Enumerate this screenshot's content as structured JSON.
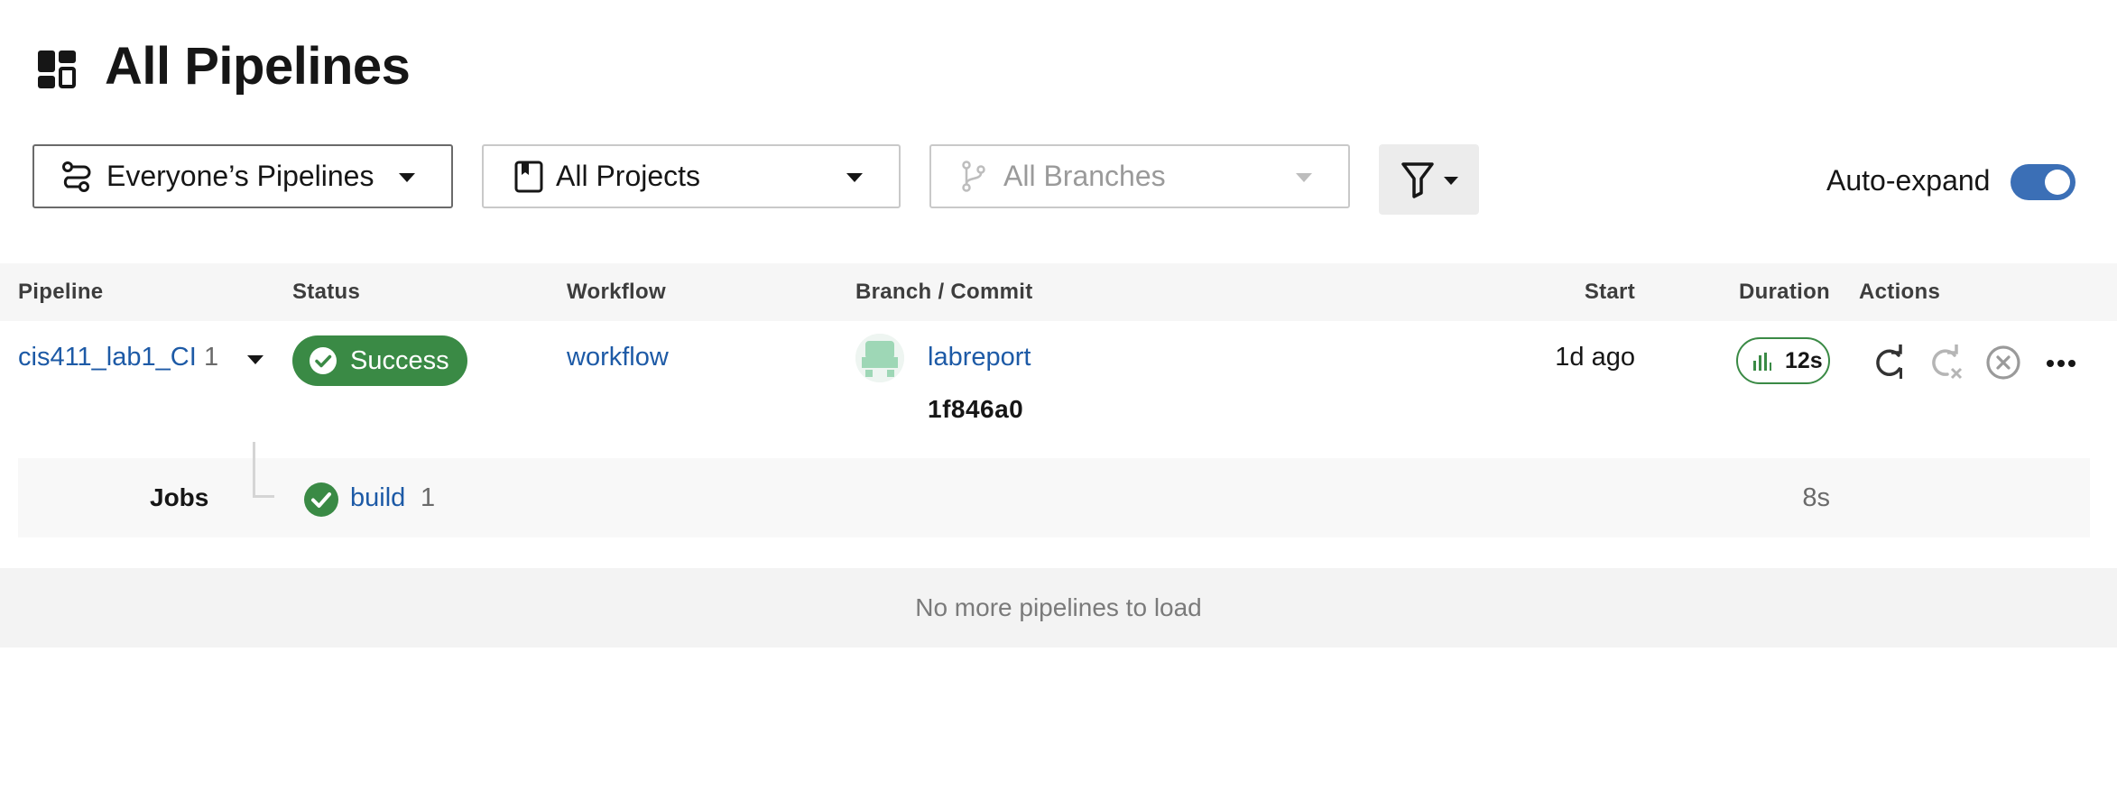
{
  "header": {
    "title": "All Pipelines",
    "icon": "dashboard-icon"
  },
  "filters": {
    "owner": {
      "label": "Everyone’s Pipelines",
      "icon": "pipelines-icon"
    },
    "project": {
      "label": "All Projects",
      "icon": "bookmark-icon"
    },
    "branch": {
      "label": "All Branches",
      "icon": "branch-icon",
      "disabled": true
    },
    "filter_button_icon": "filter-icon",
    "auto_expand": {
      "label": "Auto-expand",
      "on": true
    }
  },
  "table": {
    "columns": {
      "pipeline": "Pipeline",
      "status": "Status",
      "workflow": "Workflow",
      "branch_commit": "Branch / Commit",
      "start": "Start",
      "duration": "Duration",
      "actions": "Actions"
    },
    "rows": [
      {
        "pipeline": "cis411_lab1_CI",
        "number": "1",
        "status": "Success",
        "workflow": "workflow",
        "branch": "labreport",
        "commit": "1f846a0",
        "start": "1d ago",
        "duration": "12s",
        "actions": [
          "rerun-icon",
          "rerun-failed-icon",
          "cancel-icon",
          "more-icon"
        ],
        "jobs": {
          "label": "Jobs",
          "items": [
            {
              "name": "build",
              "number": "1",
              "duration": "8s",
              "status": "success"
            }
          ]
        }
      }
    ]
  },
  "footer": {
    "message": "No more pipelines to load"
  },
  "colors": {
    "success": "#3a8a45",
    "link": "#1d5aa6",
    "toggle": "#3b6fb6"
  }
}
